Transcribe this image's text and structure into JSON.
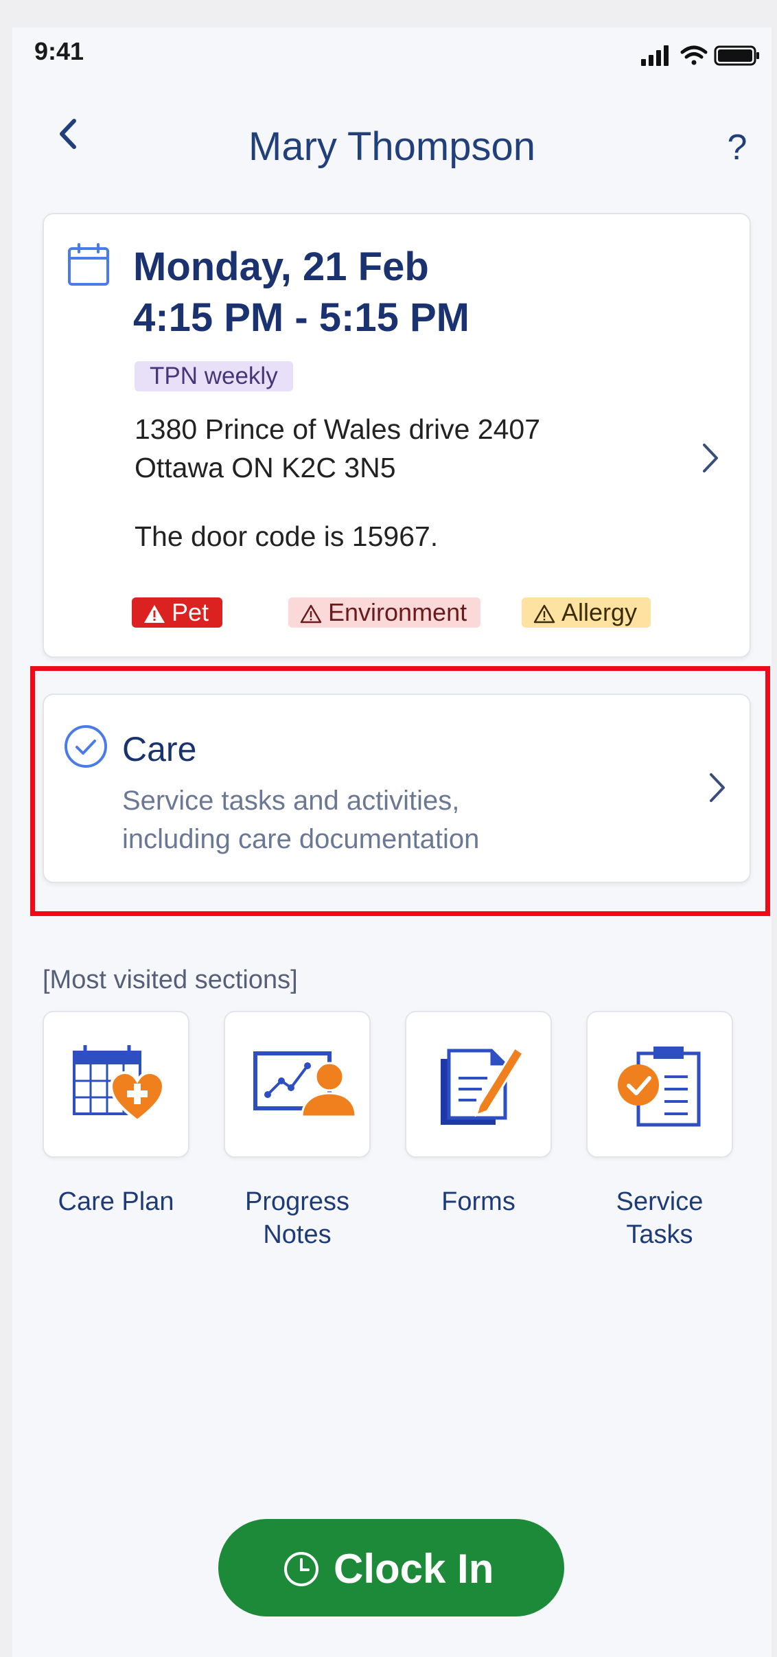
{
  "status_bar": {
    "time": "9:41"
  },
  "header": {
    "title": "Mary Thompson",
    "help_label": "?"
  },
  "appointment": {
    "date": "Monday, 21 Feb",
    "time_range": "4:15 PM - 5:15 PM",
    "tag": "TPN weekly",
    "address_line1": "1380 Prince of Wales drive 2407",
    "address_line2": "Ottawa ON K2C 3N5",
    "note": "The door code is 15967.",
    "alerts": [
      {
        "label": "Pet",
        "color": "#dc2121"
      },
      {
        "label": "Environment",
        "color": "#fbd9d9"
      },
      {
        "label": "Allergy",
        "color": "#fde2a2"
      }
    ]
  },
  "care": {
    "title": "Care",
    "description_line1": "Service tasks and activities,",
    "description_line2": "including care documentation"
  },
  "most_visited": {
    "label": "[Most visited sections]",
    "tiles": [
      {
        "line1": "Care Plan",
        "line2": "",
        "icon": "care-plan-icon"
      },
      {
        "line1": "Progress",
        "line2": "Notes",
        "icon": "progress-notes-icon"
      },
      {
        "line1": "Forms",
        "line2": "",
        "icon": "forms-icon"
      },
      {
        "line1": "Service",
        "line2": "Tasks",
        "icon": "service-tasks-icon"
      }
    ]
  },
  "clock_in": {
    "label": "Clock In",
    "color": "#1d8a3a"
  },
  "colors": {
    "primary": "#1a3270",
    "accent_orange": "#f07f1e",
    "icon_blue": "#2e4fc2",
    "highlight": "#ee0a16"
  }
}
